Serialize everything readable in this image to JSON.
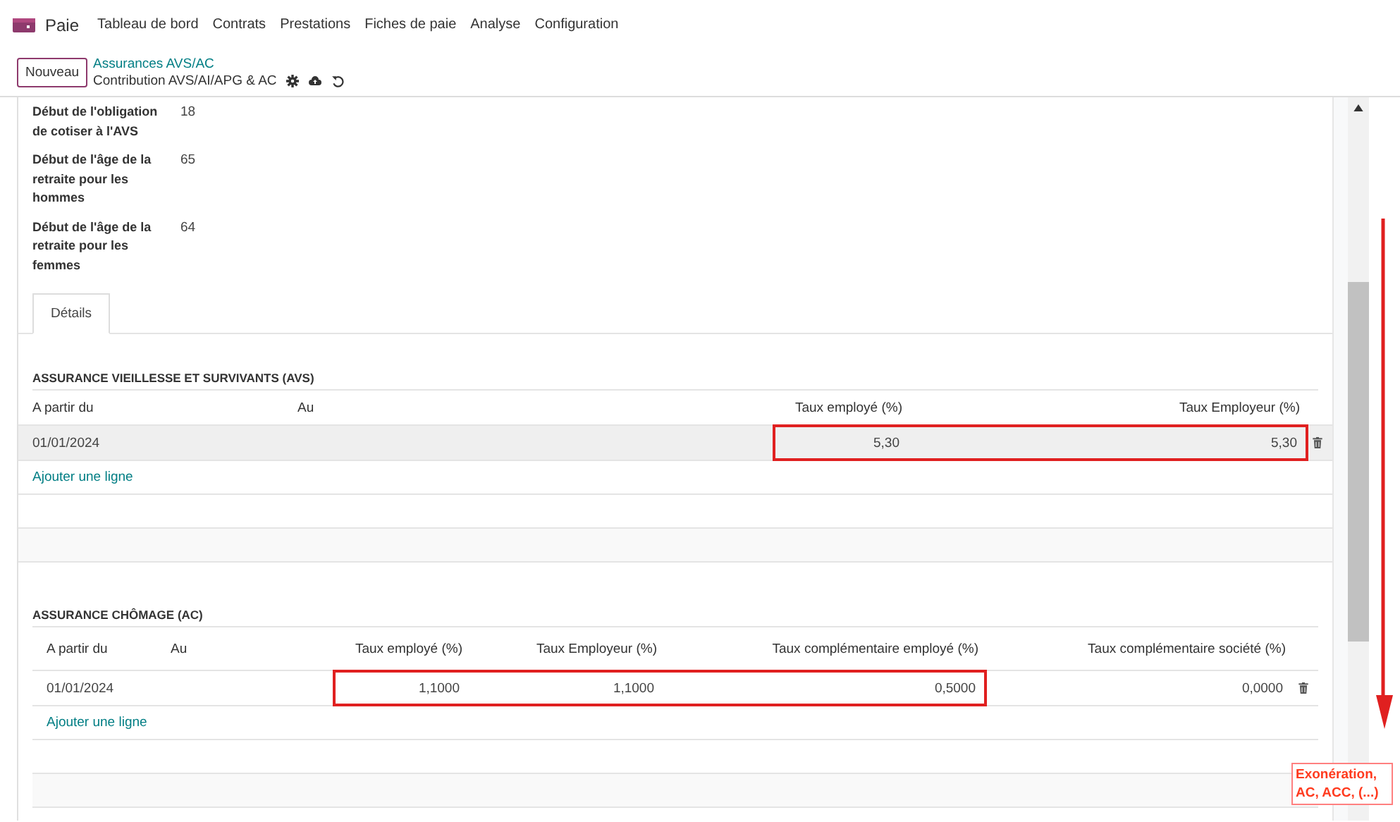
{
  "app": {
    "name": "Paie"
  },
  "menu": [
    {
      "label": "Tableau de bord"
    },
    {
      "label": "Contrats"
    },
    {
      "label": "Prestations"
    },
    {
      "label": "Fiches de paie"
    },
    {
      "label": "Analyse"
    },
    {
      "label": "Configuration"
    }
  ],
  "new_button": "Nouveau",
  "breadcrumb": {
    "parent": "Assurances AVS/AC",
    "current": "Contribution AVS/AI/APG & AC"
  },
  "fields": [
    {
      "label": "Début de l'obligation de cotiser à l'AVS",
      "value": "18"
    },
    {
      "label": "Début de l'âge de la retraite pour les hommes",
      "value": "65"
    },
    {
      "label": "Début de l'âge de la retraite pour les femmes",
      "value": "64"
    }
  ],
  "tabs": [
    {
      "label": "Détails",
      "selected": true
    }
  ],
  "sections": [
    {
      "kind": "wide",
      "title": "ASSURANCE VIEILLESSE ET SURVIVANTS (AVS)",
      "columns": [
        "A partir du",
        "Au",
        "Taux employé (%)",
        "Taux Employeur (%)"
      ],
      "rows": [
        {
          "selected": true,
          "cells": [
            {
              "text": "01/01/2024",
              "highlighted": false
            },
            {
              "highlighted": false
            },
            {
              "text": "5,30",
              "highlighted": true
            },
            {
              "text": "5,30",
              "highlighted": true
            }
          ]
        }
      ],
      "add_line": "Ajouter une ligne"
    },
    {
      "kind": "inset",
      "title": "ASSURANCE CHÔMAGE (AC)",
      "columns": [
        "A partir du",
        "Au",
        "Taux employé (%)",
        "Taux Employeur (%)",
        "Taux complémentaire employé (%)",
        "Taux complémentaire société (%)"
      ],
      "rows": [
        {
          "selected": false,
          "cells": [
            {
              "text": "01/01/2024",
              "highlighted": false
            },
            {
              "highlighted": false
            },
            {
              "text": "1,1000",
              "highlighted": true
            },
            {
              "text": "1,1000",
              "highlighted": true
            },
            {
              "text": "0,5000",
              "highlighted": true
            },
            {
              "text": "0,0000",
              "highlighted": false
            }
          ]
        }
      ],
      "add_line": "Ajouter une ligne"
    }
  ],
  "annotation": {
    "text": "Exonération, AC, ACC, (...)"
  }
}
